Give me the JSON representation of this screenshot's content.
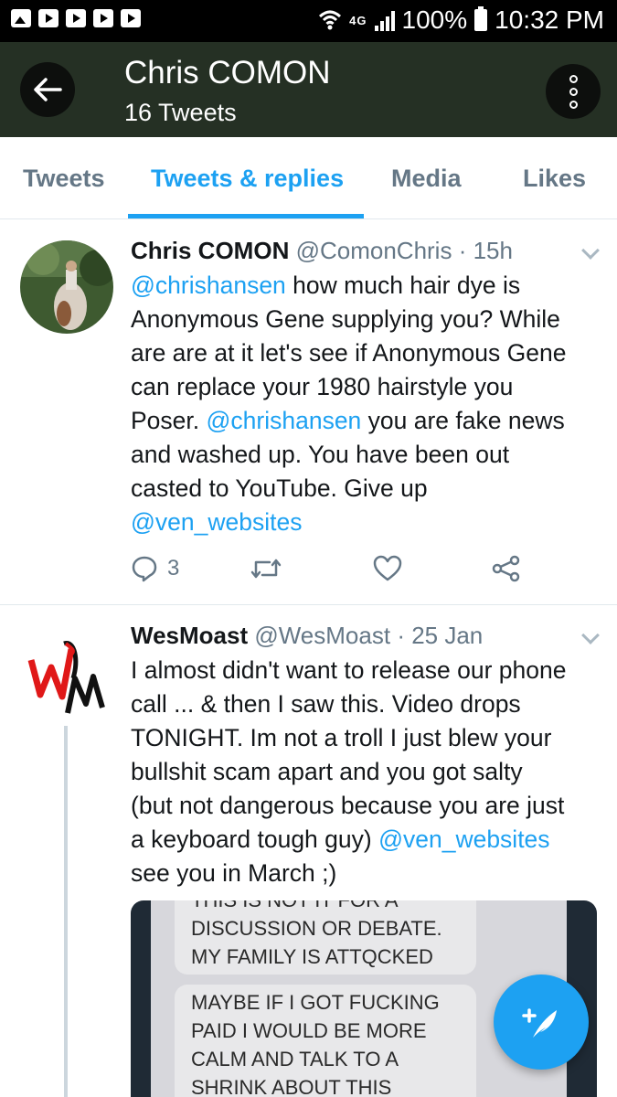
{
  "status_bar": {
    "battery": "100%",
    "time": "10:32 PM",
    "network": "4G",
    "icons": [
      "image-icon",
      "youtube-icon",
      "youtube-icon",
      "youtube-icon",
      "youtube-icon",
      "wifi-icon",
      "signal-icon",
      "battery-icon"
    ]
  },
  "header": {
    "title": "Chris COMON",
    "subtitle": "16 Tweets",
    "back_icon": "arrow-left-icon",
    "more_icon": "more-vertical-icon",
    "bg_color": "#253024"
  },
  "tabs": [
    {
      "label": "Tweets",
      "active": false
    },
    {
      "label": "Tweets & replies",
      "active": true
    },
    {
      "label": "Media",
      "active": false
    },
    {
      "label": "Likes",
      "active": false
    }
  ],
  "accent_color": "#1da1f2",
  "tweets": [
    {
      "name": "Chris COMON",
      "handle": "@ComonChris",
      "time": "· 15h",
      "lines": [
        [
          {
            "t": "@chrishansen",
            "m": true
          },
          {
            "t": " how much hair dye is"
          }
        ],
        [
          {
            "t": "Anonymous Gene supplying you? While"
          }
        ],
        [
          {
            "t": "are are at it let's see if Anonymous Gene"
          }
        ],
        [
          {
            "t": "can replace your 1980 hairstyle you"
          }
        ],
        [
          {
            "t": "Poser. "
          },
          {
            "t": "@chrishansen",
            "m": true
          },
          {
            "t": " you are fake news"
          }
        ],
        [
          {
            "t": "and washed up. You have been out"
          }
        ],
        [
          {
            "t": "casted to YouTube. Give up"
          }
        ],
        [
          {
            "t": "@ven_websites",
            "m": true
          }
        ]
      ],
      "reply_count": "3"
    },
    {
      "name": "WesMoast",
      "handle": "@WesMoast",
      "time": "· 25 Jan",
      "lines": [
        [
          {
            "t": "I almost didn't want to release our phone"
          }
        ],
        [
          {
            "t": "call ... & then I saw this. Video drops"
          }
        ],
        [
          {
            "t": "TONIGHT. Im not a troll I just blew your"
          }
        ],
        [
          {
            "t": "bullshit scam apart and you got salty"
          }
        ],
        [
          {
            "t": "(but not dangerous because you are just"
          }
        ],
        [
          {
            "t": "a keyboard tough guy) "
          },
          {
            "t": "@ven_websites",
            "m": true
          }
        ],
        [
          {
            "t": "see you in March ;)"
          }
        ]
      ],
      "media_bubbles": [
        [
          "THIS IS NOT IT FOR A",
          "DISCUSSION OR DEBATE.",
          "MY FAMILY IS ATTQCKED"
        ],
        [
          "MAYBE IF I GOT FUCKING",
          "PAID I WOULD BE MORE",
          "CALM AND TALK TO A",
          "SHRINK ABOUT THIS"
        ]
      ]
    }
  ],
  "fab": {
    "icon": "compose-tweet-icon"
  }
}
